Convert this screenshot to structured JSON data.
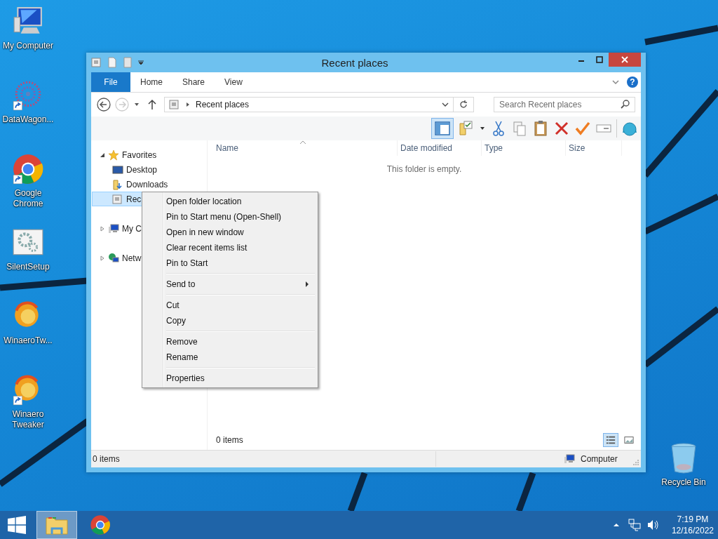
{
  "desktop_icons": [
    {
      "label": "My Computer",
      "kind": "computer",
      "shortcut": false
    },
    {
      "label": "DataWagon...",
      "kind": "datawagon",
      "shortcut": true
    },
    {
      "label": "Google Chrome",
      "kind": "chrome",
      "shortcut": true
    },
    {
      "label": "SilentSetup",
      "kind": "setup",
      "shortcut": false
    },
    {
      "label": "WinaeroTw...",
      "kind": "winaero",
      "shortcut": false
    },
    {
      "label": "Winaero Tweaker",
      "kind": "winaero",
      "shortcut": true
    }
  ],
  "recycle_bin": {
    "label": "Recycle Bin"
  },
  "window": {
    "title": "Recent places",
    "ribbon_tabs": [
      {
        "label": "File",
        "kind": "file"
      },
      {
        "label": "Home",
        "kind": "tab"
      },
      {
        "label": "Share",
        "kind": "tab"
      },
      {
        "label": "View",
        "kind": "tab"
      }
    ],
    "help": "?",
    "address": {
      "path": "Recent places"
    },
    "search": {
      "placeholder": "Search Recent places"
    },
    "nav_tree": [
      {
        "label": "Favorites",
        "kind": "star",
        "expanded": true,
        "selected": false,
        "children": [
          {
            "label": "Desktop",
            "kind": "desktop",
            "selected": false
          },
          {
            "label": "Downloads",
            "kind": "downloads",
            "selected": false
          },
          {
            "label": "Rec",
            "kind": "recent",
            "selected": true
          }
        ]
      },
      {
        "label": "My C",
        "kind": "computer",
        "expanded": false,
        "selected": false
      },
      {
        "label": "Netw",
        "kind": "network",
        "expanded": false,
        "selected": false
      }
    ],
    "columns": [
      "Name",
      "Date modified",
      "Type",
      "Size"
    ],
    "empty_message": "This folder is empty.",
    "item_count": "0 items",
    "views": [
      {
        "kind": "details",
        "selected": true
      },
      {
        "kind": "large_icons",
        "selected": false
      }
    ],
    "status_bar": {
      "items": "0 items",
      "location": "Computer"
    }
  },
  "context_menu": {
    "groups": [
      [
        {
          "label": "Open folder location",
          "submenu": false
        },
        {
          "label": "Pin to Start menu (Open-Shell)",
          "submenu": false
        },
        {
          "label": "Open in new window",
          "submenu": false
        },
        {
          "label": "Clear recent items list",
          "submenu": false
        },
        {
          "label": "Pin to Start",
          "submenu": false
        }
      ],
      [
        {
          "label": "Send to",
          "submenu": true
        }
      ],
      [
        {
          "label": "Cut",
          "submenu": false
        },
        {
          "label": "Copy",
          "submenu": false
        }
      ],
      [
        {
          "label": "Remove",
          "submenu": false
        },
        {
          "label": "Rename",
          "submenu": false
        }
      ],
      [
        {
          "label": "Properties",
          "submenu": false
        }
      ]
    ]
  },
  "taskbar": {
    "apps": [
      {
        "kind": "explorer",
        "active": true
      },
      {
        "kind": "chrome",
        "active": false
      }
    ],
    "time": "7:19 PM",
    "date": "12/16/2022"
  }
}
